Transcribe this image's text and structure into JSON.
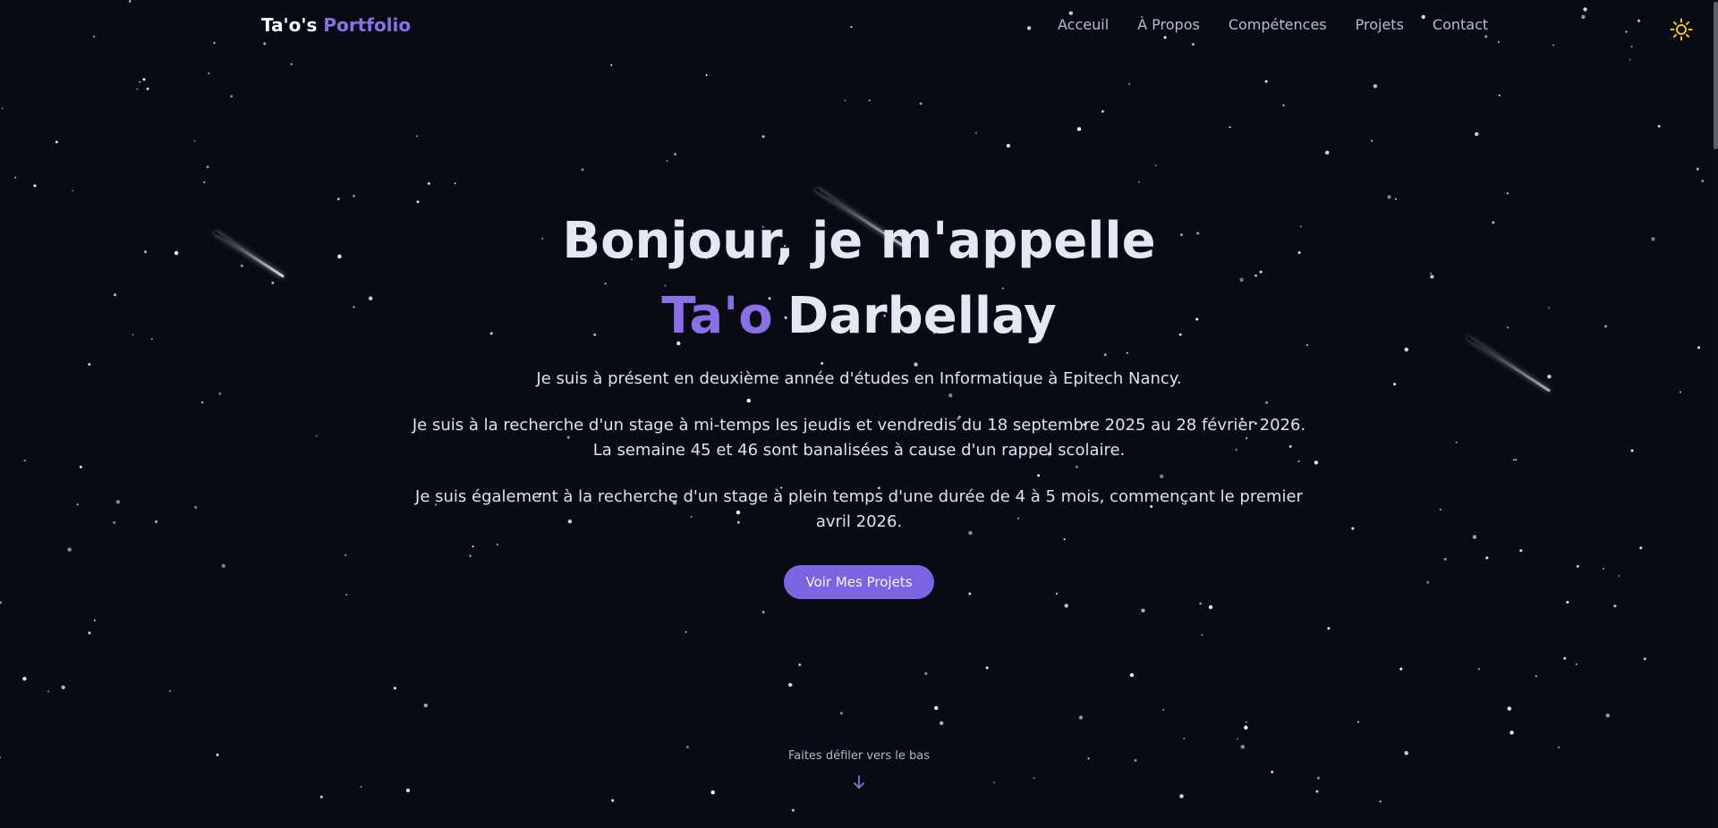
{
  "nav": {
    "brand_main": "Ta'o's",
    "brand_accent": "Portfolio",
    "links": [
      "Acceuil",
      "À Propos",
      "Compétences",
      "Projets",
      "Contact"
    ],
    "theme_toggle_icon": "sun-icon"
  },
  "hero": {
    "title_line1": "Bonjour, je m'appelle",
    "first_name": "Ta'o",
    "last_name": "Darbellay",
    "paragraph1": "Je suis à présent en deuxième année d'études en Informatique à Epitech Nancy.",
    "paragraph2_line1": "Je suis à la recherche d'un stage à mi-temps les jeudis et vendredis du 18 septembre 2025 au 28 février 2026.",
    "paragraph2_line2": "La semaine 45 et 46 sont banalisées à cause d'un rappel scolaire.",
    "paragraph3": "Je suis également à la recherche d'un stage à plein temps d'une durée de 4 à 5 mois, commençant le premier avril 2026.",
    "cta_label": "Voir Mes Projets"
  },
  "scroll": {
    "hint": "Faites défiler vers le bas",
    "icon": "arrow-down-icon"
  },
  "colors": {
    "background": "#080a14",
    "accent": "#8b6fe6",
    "button": "#7c64e0",
    "sun": "#f5c518"
  }
}
